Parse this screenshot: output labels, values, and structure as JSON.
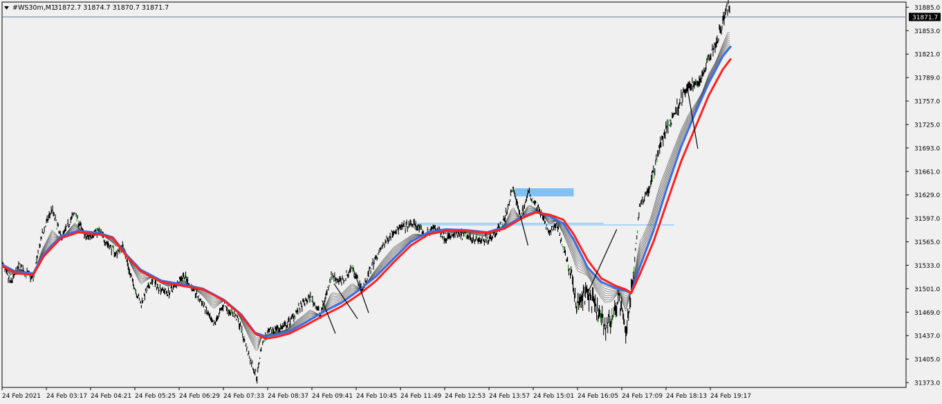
{
  "header": {
    "symbol": "#WS30m,M1",
    "ohlc": "31872.7 31874.7 31870.7 31871.7",
    "menu_icon": "triangle-down-icon"
  },
  "price_marker": {
    "value": "31871.7"
  },
  "colors": {
    "background": "#f0f0f0",
    "price_line": "#6e7e96",
    "candle": "#000000",
    "bull_accent": "#1d9a1d",
    "ema_red": "#ff2020",
    "ema_blue": "#3b6ee0",
    "ribbon": "#303030",
    "zone": "#80c0f5",
    "zone_line": "#a9d4f5",
    "trendline": "#000000",
    "marker_bg": "#000000",
    "marker_text": "#ffffff"
  },
  "chart_data": {
    "type": "line",
    "title": "#WS30m,M1",
    "timeframe": "M1",
    "grid": false,
    "ylim": [
      31373.0,
      31892.0
    ],
    "y_ticks": [
      "31885.0",
      "31853.0",
      "31821.0",
      "31789.0",
      "31757.0",
      "31725.0",
      "31693.0",
      "31661.0",
      "31629.0",
      "31597.0",
      "31565.0",
      "31533.0",
      "31501.0",
      "31469.0",
      "31437.0",
      "31405.0",
      "31373.0"
    ],
    "x_ticks": [
      "24 Feb 2021",
      "24 Feb 03:17",
      "24 Feb 04:21",
      "24 Feb 05:25",
      "24 Feb 06:29",
      "24 Feb 07:33",
      "24 Feb 08:37",
      "24 Feb 09:41",
      "24 Feb 10:45",
      "24 Feb 11:49",
      "24 Feb 12:53",
      "24 Feb 13:57",
      "24 Feb 15:01",
      "24 Feb 16:05",
      "24 Feb 17:09",
      "24 Feb 18:13",
      "24 Feb 19:17"
    ],
    "x_range": [
      0,
      1050
    ],
    "price_anchors": [
      [
        0,
        31535
      ],
      [
        12,
        31508
      ],
      [
        25,
        31532
      ],
      [
        38,
        31520
      ],
      [
        45,
        31515
      ],
      [
        58,
        31575
      ],
      [
        72,
        31610
      ],
      [
        85,
        31570
      ],
      [
        105,
        31605
      ],
      [
        120,
        31570
      ],
      [
        140,
        31580
      ],
      [
        150,
        31565
      ],
      [
        165,
        31548
      ],
      [
        175,
        31560
      ],
      [
        185,
        31520
      ],
      [
        200,
        31480
      ],
      [
        215,
        31510
      ],
      [
        240,
        31495
      ],
      [
        262,
        31520
      ],
      [
        275,
        31500
      ],
      [
        290,
        31480
      ],
      [
        305,
        31450
      ],
      [
        320,
        31480
      ],
      [
        340,
        31460
      ],
      [
        358,
        31405
      ],
      [
        368,
        31380
      ],
      [
        375,
        31430
      ],
      [
        390,
        31445
      ],
      [
        410,
        31450
      ],
      [
        425,
        31470
      ],
      [
        445,
        31490
      ],
      [
        460,
        31465
      ],
      [
        475,
        31520
      ],
      [
        490,
        31510
      ],
      [
        505,
        31530
      ],
      [
        520,
        31500
      ],
      [
        535,
        31535
      ],
      [
        550,
        31560
      ],
      [
        565,
        31580
      ],
      [
        580,
        31585
      ],
      [
        595,
        31590
      ],
      [
        610,
        31575
      ],
      [
        625,
        31585
      ],
      [
        640,
        31570
      ],
      [
        660,
        31575
      ],
      [
        680,
        31570
      ],
      [
        695,
        31565
      ],
      [
        710,
        31575
      ],
      [
        725,
        31595
      ],
      [
        737,
        31638
      ],
      [
        748,
        31600
      ],
      [
        760,
        31632
      ],
      [
        775,
        31610
      ],
      [
        790,
        31575
      ],
      [
        800,
        31590
      ],
      [
        815,
        31540
      ],
      [
        830,
        31480
      ],
      [
        845,
        31495
      ],
      [
        858,
        31470
      ],
      [
        870,
        31450
      ],
      [
        880,
        31460
      ],
      [
        890,
        31490
      ],
      [
        900,
        31440
      ],
      [
        910,
        31510
      ],
      [
        920,
        31615
      ],
      [
        935,
        31640
      ],
      [
        950,
        31700
      ],
      [
        965,
        31730
      ],
      [
        980,
        31760
      ],
      [
        990,
        31775
      ],
      [
        1000,
        31780
      ],
      [
        1010,
        31790
      ],
      [
        1020,
        31820
      ],
      [
        1030,
        31835
      ],
      [
        1042,
        31870
      ],
      [
        1048,
        31888
      ],
      [
        1052,
        31872
      ]
    ],
    "ema_red": [
      [
        0,
        31532
      ],
      [
        20,
        31522
      ],
      [
        45,
        31520
      ],
      [
        60,
        31545
      ],
      [
        85,
        31570
      ],
      [
        110,
        31578
      ],
      [
        140,
        31575
      ],
      [
        160,
        31570
      ],
      [
        180,
        31545
      ],
      [
        200,
        31525
      ],
      [
        230,
        31510
      ],
      [
        260,
        31505
      ],
      [
        290,
        31500
      ],
      [
        320,
        31485
      ],
      [
        345,
        31465
      ],
      [
        365,
        31440
      ],
      [
        380,
        31433
      ],
      [
        395,
        31435
      ],
      [
        415,
        31440
      ],
      [
        440,
        31452
      ],
      [
        465,
        31465
      ],
      [
        490,
        31477
      ],
      [
        515,
        31493
      ],
      [
        540,
        31512
      ],
      [
        565,
        31537
      ],
      [
        590,
        31560
      ],
      [
        615,
        31575
      ],
      [
        640,
        31580
      ],
      [
        670,
        31580
      ],
      [
        700,
        31577
      ],
      [
        725,
        31583
      ],
      [
        750,
        31597
      ],
      [
        770,
        31605
      ],
      [
        790,
        31602
      ],
      [
        810,
        31595
      ],
      [
        825,
        31575
      ],
      [
        845,
        31540
      ],
      [
        865,
        31515
      ],
      [
        885,
        31505
      ],
      [
        900,
        31500
      ],
      [
        908,
        31495
      ],
      [
        920,
        31520
      ],
      [
        940,
        31565
      ],
      [
        960,
        31620
      ],
      [
        980,
        31675
      ],
      [
        1000,
        31720
      ],
      [
        1020,
        31765
      ],
      [
        1040,
        31800
      ],
      [
        1052,
        31815
      ]
    ],
    "ema_blue": [
      [
        0,
        31534
      ],
      [
        20,
        31524
      ],
      [
        45,
        31522
      ],
      [
        60,
        31548
      ],
      [
        85,
        31573
      ],
      [
        110,
        31580
      ],
      [
        140,
        31577
      ],
      [
        160,
        31571
      ],
      [
        180,
        31547
      ],
      [
        200,
        31527
      ],
      [
        230,
        31512
      ],
      [
        260,
        31507
      ],
      [
        290,
        31501
      ],
      [
        320,
        31486
      ],
      [
        345,
        31466
      ],
      [
        365,
        31441
      ],
      [
        380,
        31436
      ],
      [
        395,
        31438
      ],
      [
        415,
        31443
      ],
      [
        440,
        31456
      ],
      [
        465,
        31470
      ],
      [
        490,
        31482
      ],
      [
        515,
        31499
      ],
      [
        540,
        31518
      ],
      [
        565,
        31542
      ],
      [
        590,
        31565
      ],
      [
        615,
        31578
      ],
      [
        640,
        31582
      ],
      [
        670,
        31581
      ],
      [
        700,
        31578
      ],
      [
        725,
        31585
      ],
      [
        750,
        31599
      ],
      [
        770,
        31606
      ],
      [
        790,
        31600
      ],
      [
        810,
        31590
      ],
      [
        825,
        31568
      ],
      [
        845,
        31530
      ],
      [
        865,
        31510
      ],
      [
        885,
        31502
      ],
      [
        900,
        31498
      ],
      [
        908,
        31496
      ],
      [
        920,
        31530
      ],
      [
        940,
        31580
      ],
      [
        960,
        31640
      ],
      [
        980,
        31695
      ],
      [
        1000,
        31740
      ],
      [
        1020,
        31782
      ],
      [
        1040,
        31818
      ],
      [
        1052,
        31832
      ]
    ],
    "trendlines": [
      [
        [
          462,
          31485
        ],
        [
          481,
          31440
        ]
      ],
      [
        [
          479,
          31508
        ],
        [
          513,
          31460
        ]
      ],
      [
        [
          506,
          31530
        ],
        [
          529,
          31468
        ]
      ],
      [
        [
          737,
          31640
        ],
        [
          759,
          31560
        ]
      ],
      [
        [
          845,
          31495
        ],
        [
          887,
          31582
        ]
      ],
      [
        [
          988,
          31780
        ],
        [
          1004,
          31692
        ]
      ]
    ],
    "zones": [
      {
        "type": "box",
        "x": [
          739,
          825
        ],
        "y": [
          31627,
          31638
        ]
      },
      {
        "type": "line",
        "x": [
          598,
          868
        ],
        "y": 31590
      },
      {
        "type": "line",
        "x": [
          598,
          970
        ],
        "y": 31588
      }
    ],
    "current_price": 31871.7
  }
}
